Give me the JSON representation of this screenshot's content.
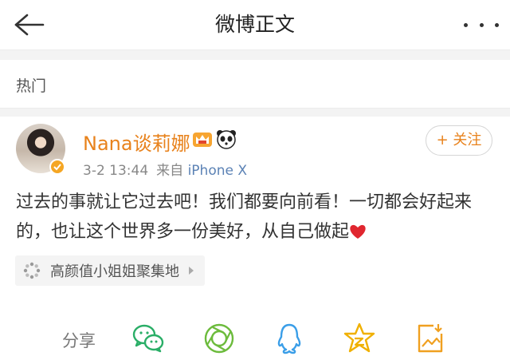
{
  "nav": {
    "title": "微博正文"
  },
  "section": {
    "label": "热门"
  },
  "post": {
    "user_name": "Nana谈莉娜",
    "time": "3-2 13:44",
    "source_prefix": "来自",
    "device": "iPhone X",
    "follow_label": "+ 关注",
    "text": "过去的事就让它过去吧！我们都要向前看！一切都会好起来的，也让这个世界多一份美好，从自己做起",
    "topic": "高颜值小姐姐聚集地"
  },
  "share": {
    "label": "分享",
    "icons": [
      "wechat-icon",
      "moments-icon",
      "qq-icon",
      "qzone-icon",
      "save-image-icon"
    ]
  },
  "colors": {
    "accent": "#e8821c",
    "link": "#5b82b5"
  }
}
